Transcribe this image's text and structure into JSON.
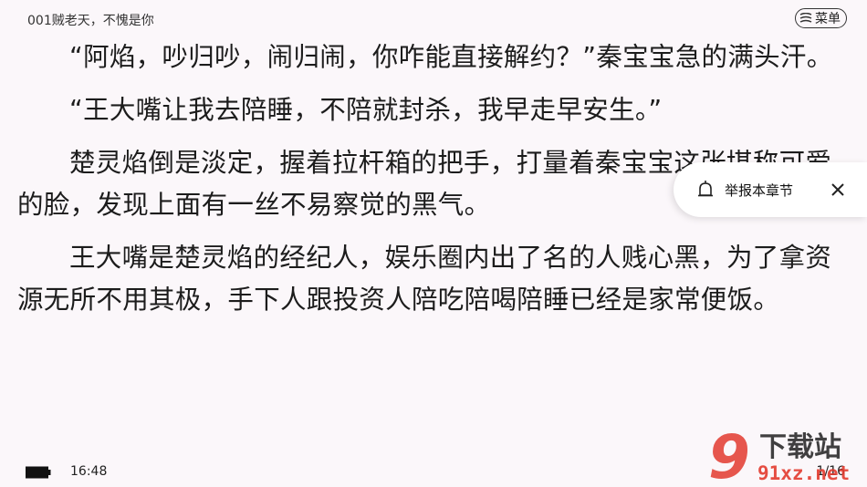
{
  "header": {
    "chapter_title": "001贼老天，不愧是你",
    "menu_label": "菜单"
  },
  "content": {
    "paragraphs": [
      "“阿焰，吵归吵，闹归闹，你咋能直接解约？”秦宝宝急的满头汗。",
      "“王大嘴让我去陪睡，不陪就封杀，我早走早安生。”",
      "楚灵焰倒是淡定，握着拉杆箱的把手，打量着秦宝宝这张堪称可爱的脸，发现上面有一丝不易察觉的黑气。",
      "王大嘴是楚灵焰的经纪人，娱乐圈内出了名的人贱心黑，为了拿资源无所不用其极，手下人跟投资人陪吃陪喝陪睡已经是家常便饭。"
    ]
  },
  "popup": {
    "report_label": "举报本章节",
    "icon": "bell-icon",
    "close_icon": "close-icon"
  },
  "status": {
    "time": "16:48",
    "page": "1/16",
    "battery_icon": "battery-icon"
  },
  "watermark": {
    "main": "下载站",
    "sub": "91xz.net",
    "logo": "9"
  },
  "colors": {
    "background": "#fbf7fa",
    "text": "#1c1c1c",
    "watermark": "#e23a2e"
  }
}
